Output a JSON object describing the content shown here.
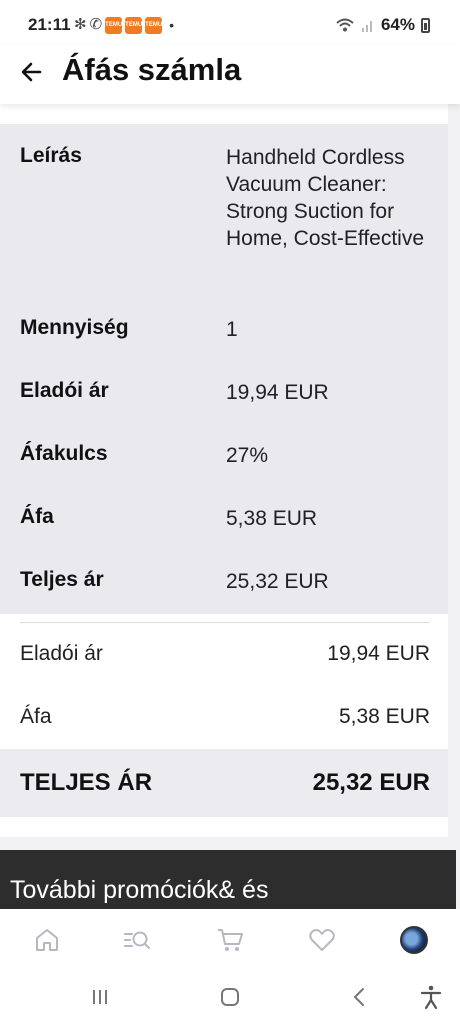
{
  "status_bar": {
    "time": "21:11",
    "notification_glyphs": [
      "pinwheel-icon",
      "viber-icon"
    ],
    "temu_badges": [
      "TEMU",
      "TEMU",
      "TEMU"
    ],
    "dot": "•",
    "battery": "64%"
  },
  "header": {
    "title": "Áfás számla",
    "back_icon": "arrow-left-icon"
  },
  "details": [
    {
      "label": "Leírás",
      "value": "Handheld Cordless Vacuum Cleaner: Strong Suction for Home, Cost-Effective"
    },
    {
      "label": "Mennyiség",
      "value": "1"
    },
    {
      "label": "Eladói ár",
      "value": "19,94 EUR"
    },
    {
      "label": "Áfakulcs",
      "value": "27%"
    },
    {
      "label": "Áfa",
      "value": "5,38 EUR"
    },
    {
      "label": "Teljes ár",
      "value": "25,32 EUR"
    }
  ],
  "summary": [
    {
      "label": "Eladói ár",
      "value": "19,94 EUR"
    },
    {
      "label": "Áfa",
      "value": "5,38 EUR"
    }
  ],
  "total": {
    "label": "TELJES ÁR",
    "value": "25,32 EUR"
  },
  "promo": {
    "title": "További promóciók& és"
  },
  "bottom_nav": [
    "home-icon",
    "search-icon",
    "cart-icon",
    "heart-icon",
    "profile-avatar"
  ],
  "system_nav": [
    "recent-apps-icon",
    "home-icon",
    "back-icon",
    "accessibility-icon"
  ],
  "colors": {
    "card_bg": "#e9e9ee",
    "promo_bg": "#2d2d2d",
    "temu_orange": "#f47a1f"
  }
}
